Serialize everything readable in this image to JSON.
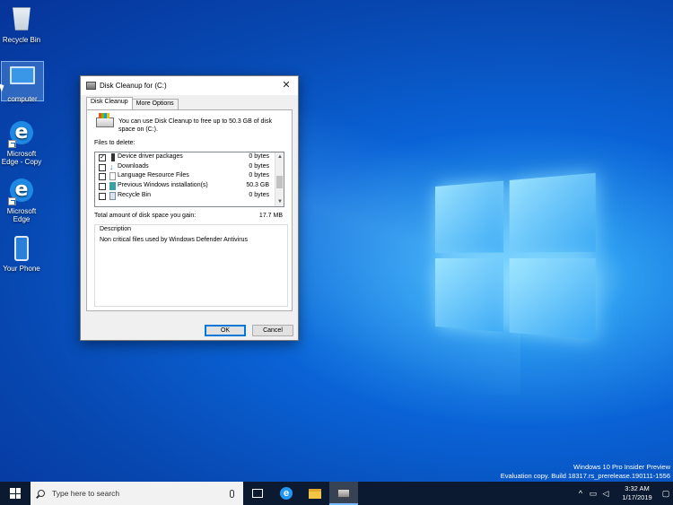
{
  "desktop": {
    "icons": [
      {
        "label": "Recycle Bin"
      },
      {
        "label": "computer"
      },
      {
        "label": "Microsoft Edge - Copy"
      },
      {
        "label": "Microsoft Edge"
      },
      {
        "label": "Your Phone"
      }
    ],
    "watermark": {
      "line1": "Windows 10 Pro Insider Preview",
      "line2": "Evaluation copy. Build 18317.rs_prerelease.190111-1556"
    }
  },
  "dialog": {
    "title": "Disk Cleanup for  (C:)",
    "close_glyph": "✕",
    "tabs": [
      {
        "label": "Disk Cleanup",
        "active": true
      },
      {
        "label": "More Options",
        "active": false
      }
    ],
    "intro_text": "You can use Disk Cleanup to free up to 50.3 GB of disk space on  (C:).",
    "files_to_delete_label": "Files to delete:",
    "files": [
      {
        "name": "Device driver packages",
        "size": "0 bytes",
        "checked": true,
        "icon": "driver-icon"
      },
      {
        "name": "Downloads",
        "size": "0 bytes",
        "checked": false,
        "icon": "download-arrow-icon"
      },
      {
        "name": "Language Resource Files",
        "size": "0 bytes",
        "checked": false,
        "icon": "document-icon"
      },
      {
        "name": "Previous Windows installation(s)",
        "size": "50.3 GB",
        "checked": false,
        "icon": "windows-install-icon"
      },
      {
        "name": "Recycle Bin",
        "size": "0 bytes",
        "checked": false,
        "icon": "recycle-bin-icon"
      }
    ],
    "check_glyph": "✓",
    "total_label": "Total amount of disk space you gain:",
    "total_value": "17.7 MB",
    "description_title": "Description",
    "description_text": "Non critical files used by Windows Defender Antivirus",
    "ok_label": "OK",
    "cancel_label": "Cancel"
  },
  "taskbar": {
    "search_placeholder": "Type here to search",
    "tray": {
      "chevron": "^",
      "time": "3:32 AM",
      "date": "1/17/2019"
    }
  },
  "colors": {
    "accent": "#0078d7",
    "taskbar": "#0b1a30",
    "desktop": "#0a63d6"
  }
}
